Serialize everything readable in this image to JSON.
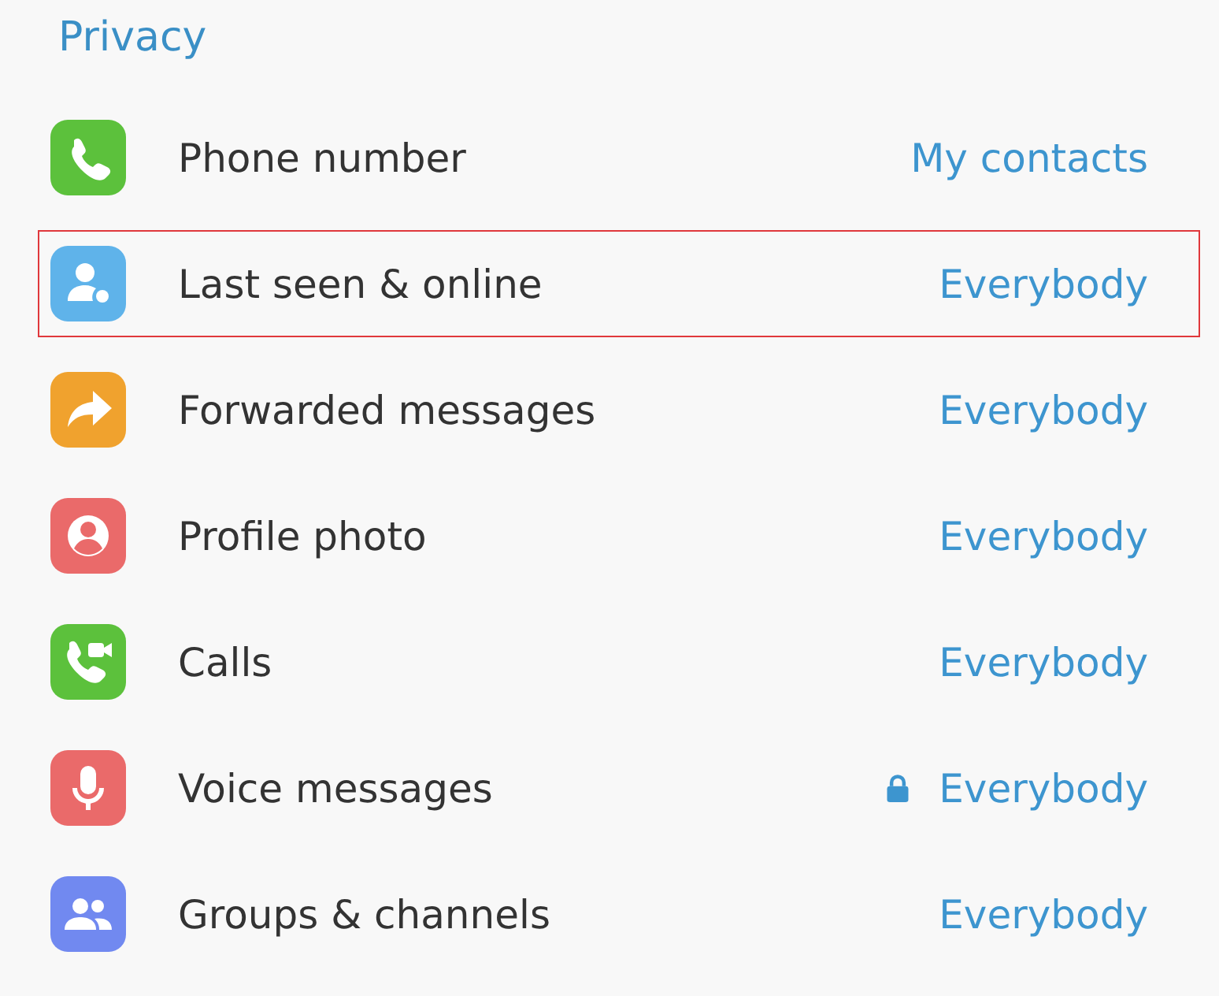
{
  "title": "Privacy",
  "rows": [
    {
      "kind": "phone",
      "color": "#5cc13c",
      "label": "Phone number",
      "value": "My contacts",
      "highlighted": false,
      "locked": false
    },
    {
      "kind": "person",
      "color": "#5fb3ea",
      "label": "Last seen & online",
      "value": "Everybody",
      "highlighted": true,
      "locked": false
    },
    {
      "kind": "forward",
      "color": "#f0a22e",
      "label": "Forwarded messages",
      "value": "Everybody",
      "highlighted": false,
      "locked": false
    },
    {
      "kind": "profile",
      "color": "#ea6a6a",
      "label": "Profile photo",
      "value": "Everybody",
      "highlighted": false,
      "locked": false
    },
    {
      "kind": "calls",
      "color": "#5cc13c",
      "label": "Calls",
      "value": "Everybody",
      "highlighted": false,
      "locked": false
    },
    {
      "kind": "voice",
      "color": "#ea6a6a",
      "label": "Voice messages",
      "value": "Everybody",
      "highlighted": false,
      "locked": true
    },
    {
      "kind": "groups",
      "color": "#7189f0",
      "label": "Groups & channels",
      "value": "Everybody",
      "highlighted": false,
      "locked": false
    }
  ]
}
